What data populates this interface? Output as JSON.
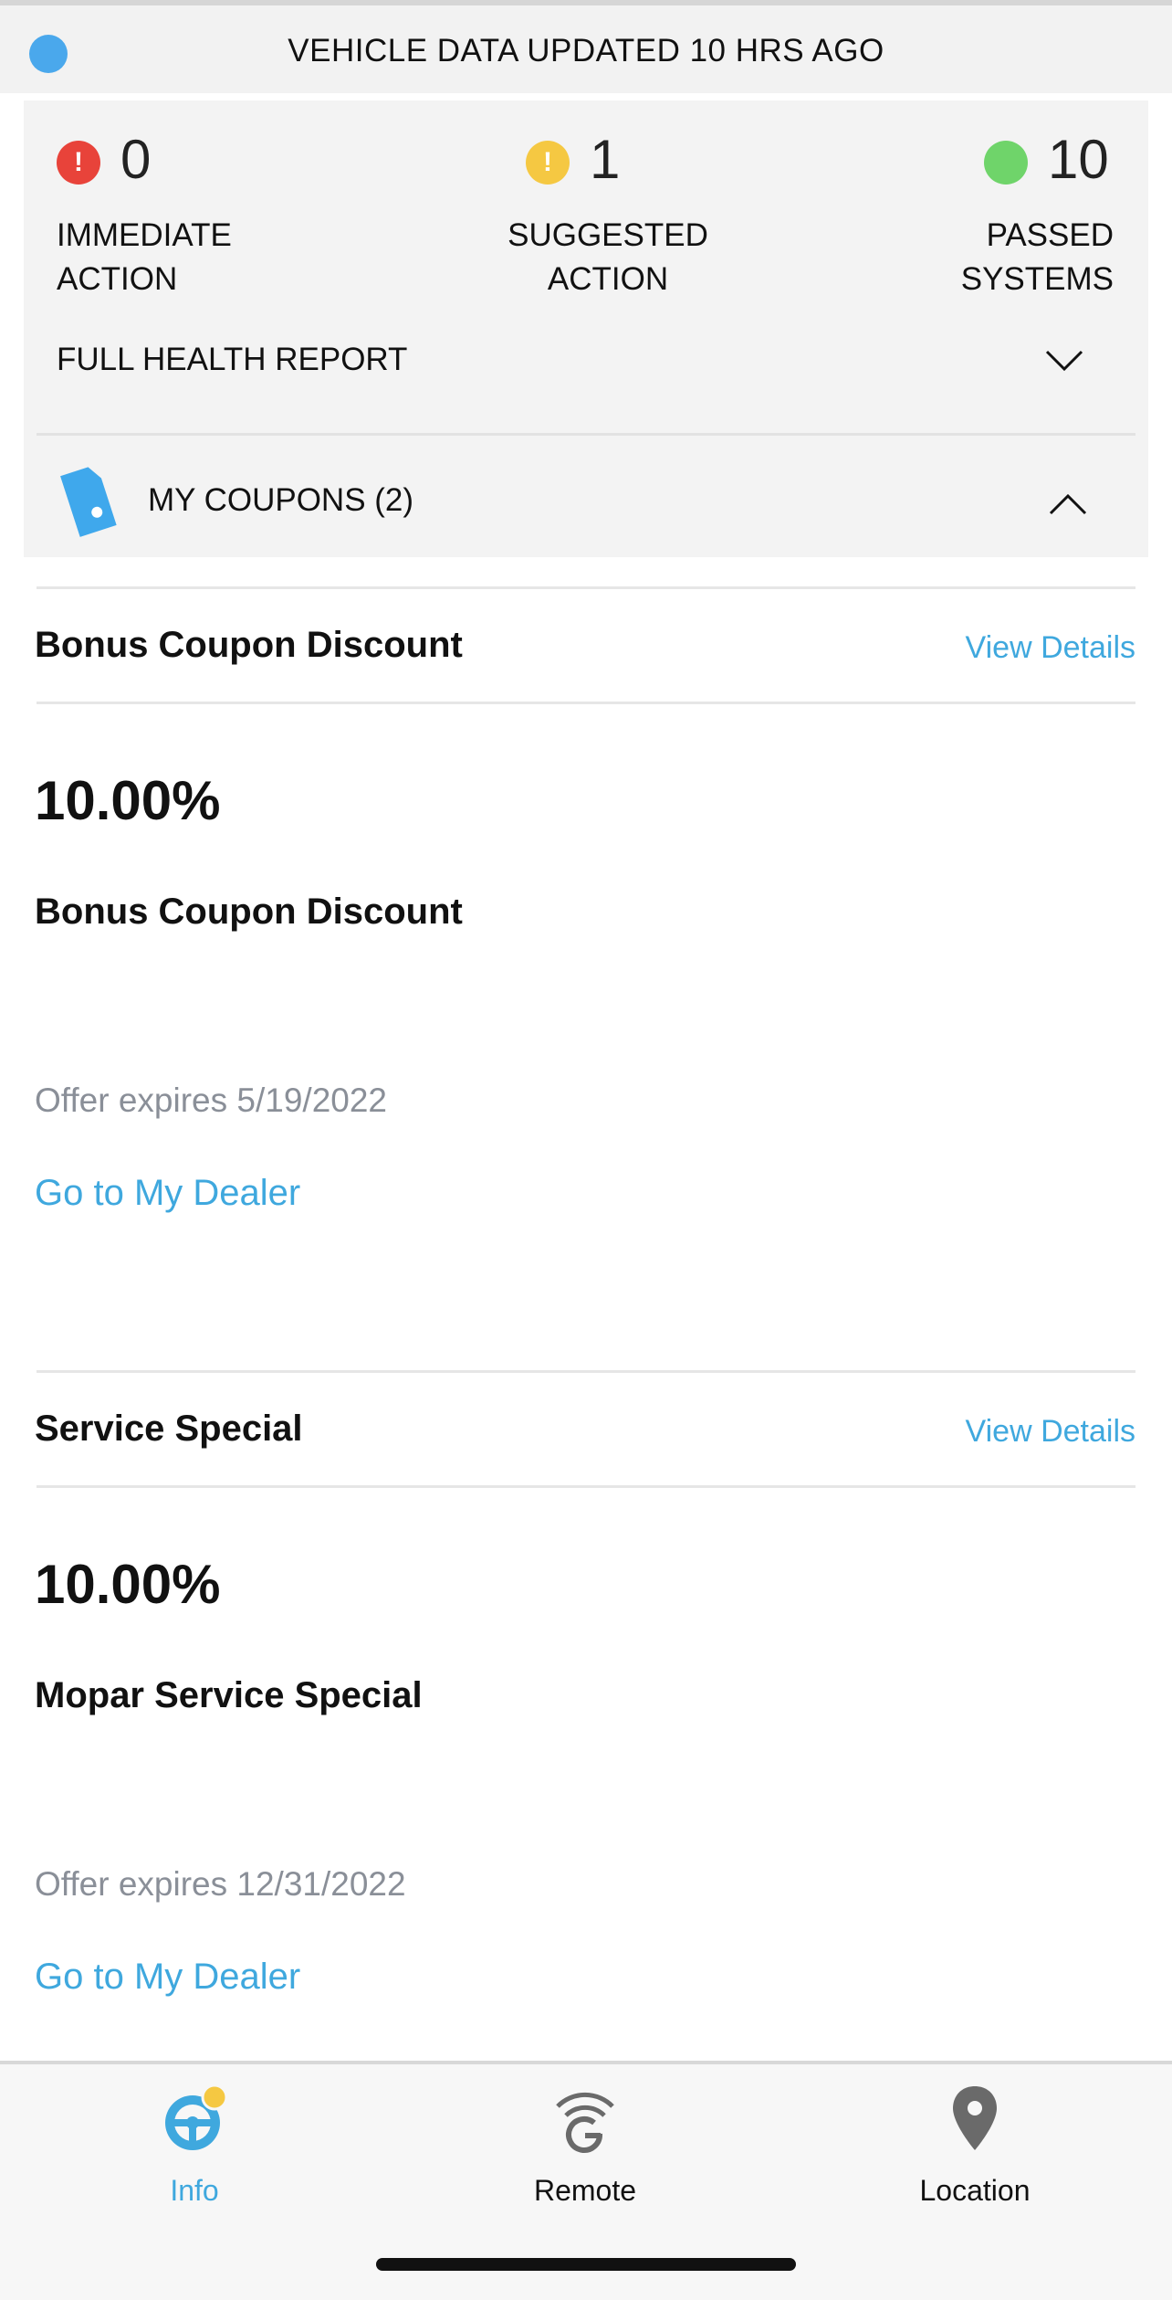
{
  "status_banner": {
    "text": "VEHICLE DATA UPDATED  10 HRS AGO",
    "dot_color": "#4aa8ec"
  },
  "health": {
    "immediate": {
      "count": "0",
      "label_line1": "IMMEDIATE",
      "label_line2": "ACTION",
      "icon_symbol": "!",
      "color": "#e8433a"
    },
    "suggested": {
      "count": "1",
      "label_line1": "SUGGESTED",
      "label_line2": "ACTION",
      "icon_symbol": "!",
      "color": "#f5c842"
    },
    "passed": {
      "count": "10",
      "label_line1": "PASSED",
      "label_line2": "SYSTEMS",
      "color": "#6fd46a"
    },
    "full_report_label": "FULL HEALTH REPORT"
  },
  "coupons_header": {
    "label": "MY COUPONS (2)",
    "tag_icon": "coupon-tag-icon"
  },
  "coupons": [
    {
      "title": "Bonus Coupon Discount",
      "view_details": "View Details",
      "value": "10.00%",
      "description": "Bonus Coupon Discount",
      "expires": "Offer expires 5/19/2022",
      "dealer_link": "Go to My Dealer"
    },
    {
      "title": "Service Special",
      "view_details": "View Details",
      "value": "10.00%",
      "description": "Mopar Service Special",
      "expires": "Offer expires 12/31/2022",
      "dealer_link": "Go to My Dealer"
    }
  ],
  "tabbar": {
    "tabs": [
      {
        "label": "Info",
        "icon": "steering-wheel-icon",
        "active": true
      },
      {
        "label": "Remote",
        "icon": "remote-signal-icon",
        "active": false
      },
      {
        "label": "Location",
        "icon": "location-pin-icon",
        "active": false
      }
    ],
    "accent_color": "#3fa8de",
    "badge_color": "#f5c842"
  }
}
